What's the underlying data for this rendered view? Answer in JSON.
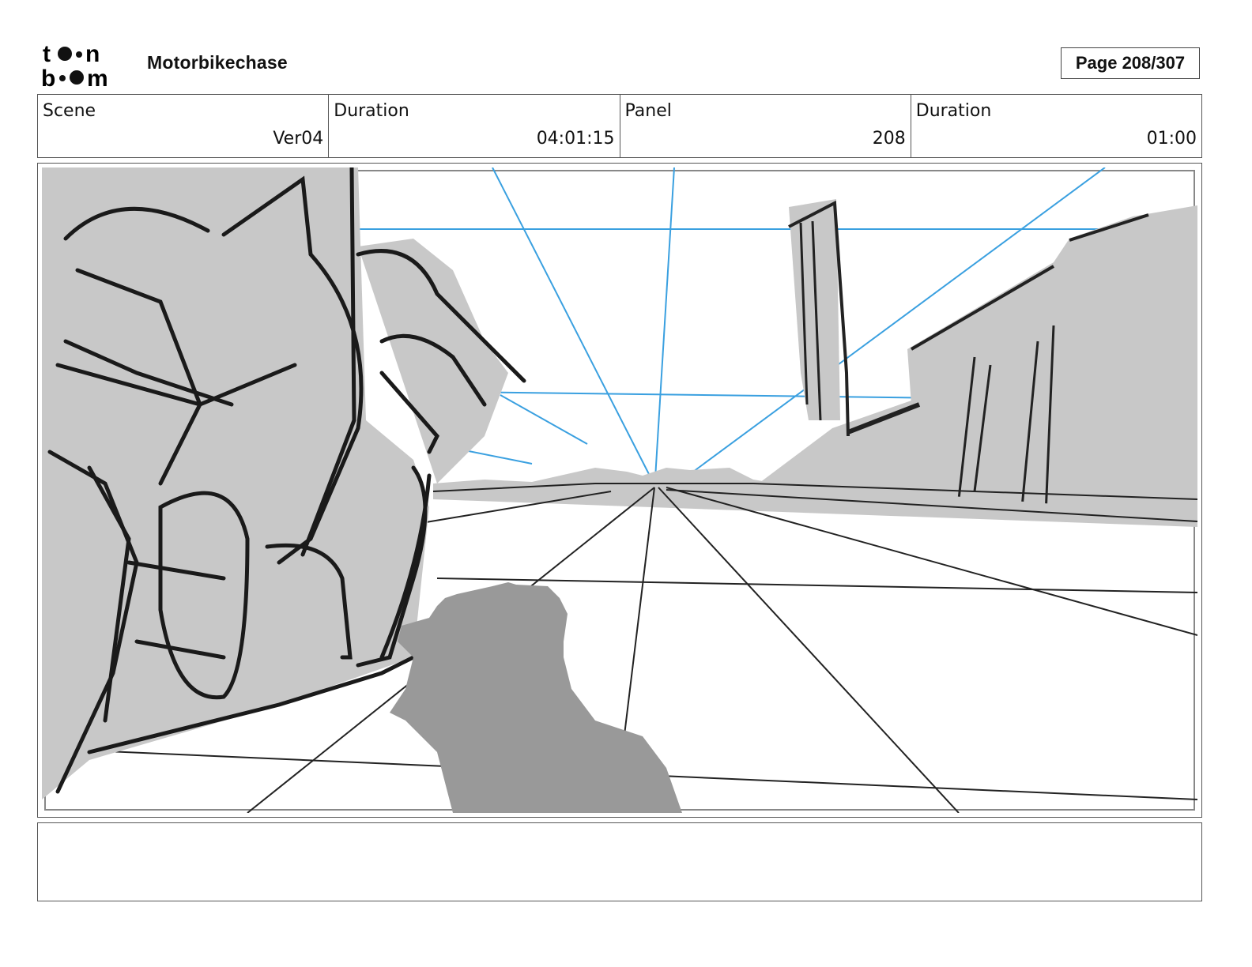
{
  "header": {
    "logo_text": "toon boom",
    "project_title": "Motorbikechase",
    "page_indicator": "Page 208/307"
  },
  "info": {
    "scene_label": "Scene",
    "scene_value": "Ver04",
    "scene_duration_label": "Duration",
    "scene_duration_value": "04:01:15",
    "panel_label": "Panel",
    "panel_value": "208",
    "panel_duration_label": "Duration",
    "panel_duration_value": "01:00"
  },
  "panel_image": {
    "description_icon": "storyboard-sketch",
    "perspective_line_color": "#3aa0e0",
    "fill_gray": "#c8c8c8",
    "silhouette_gray": "#999999"
  },
  "notes": {
    "text": ""
  }
}
